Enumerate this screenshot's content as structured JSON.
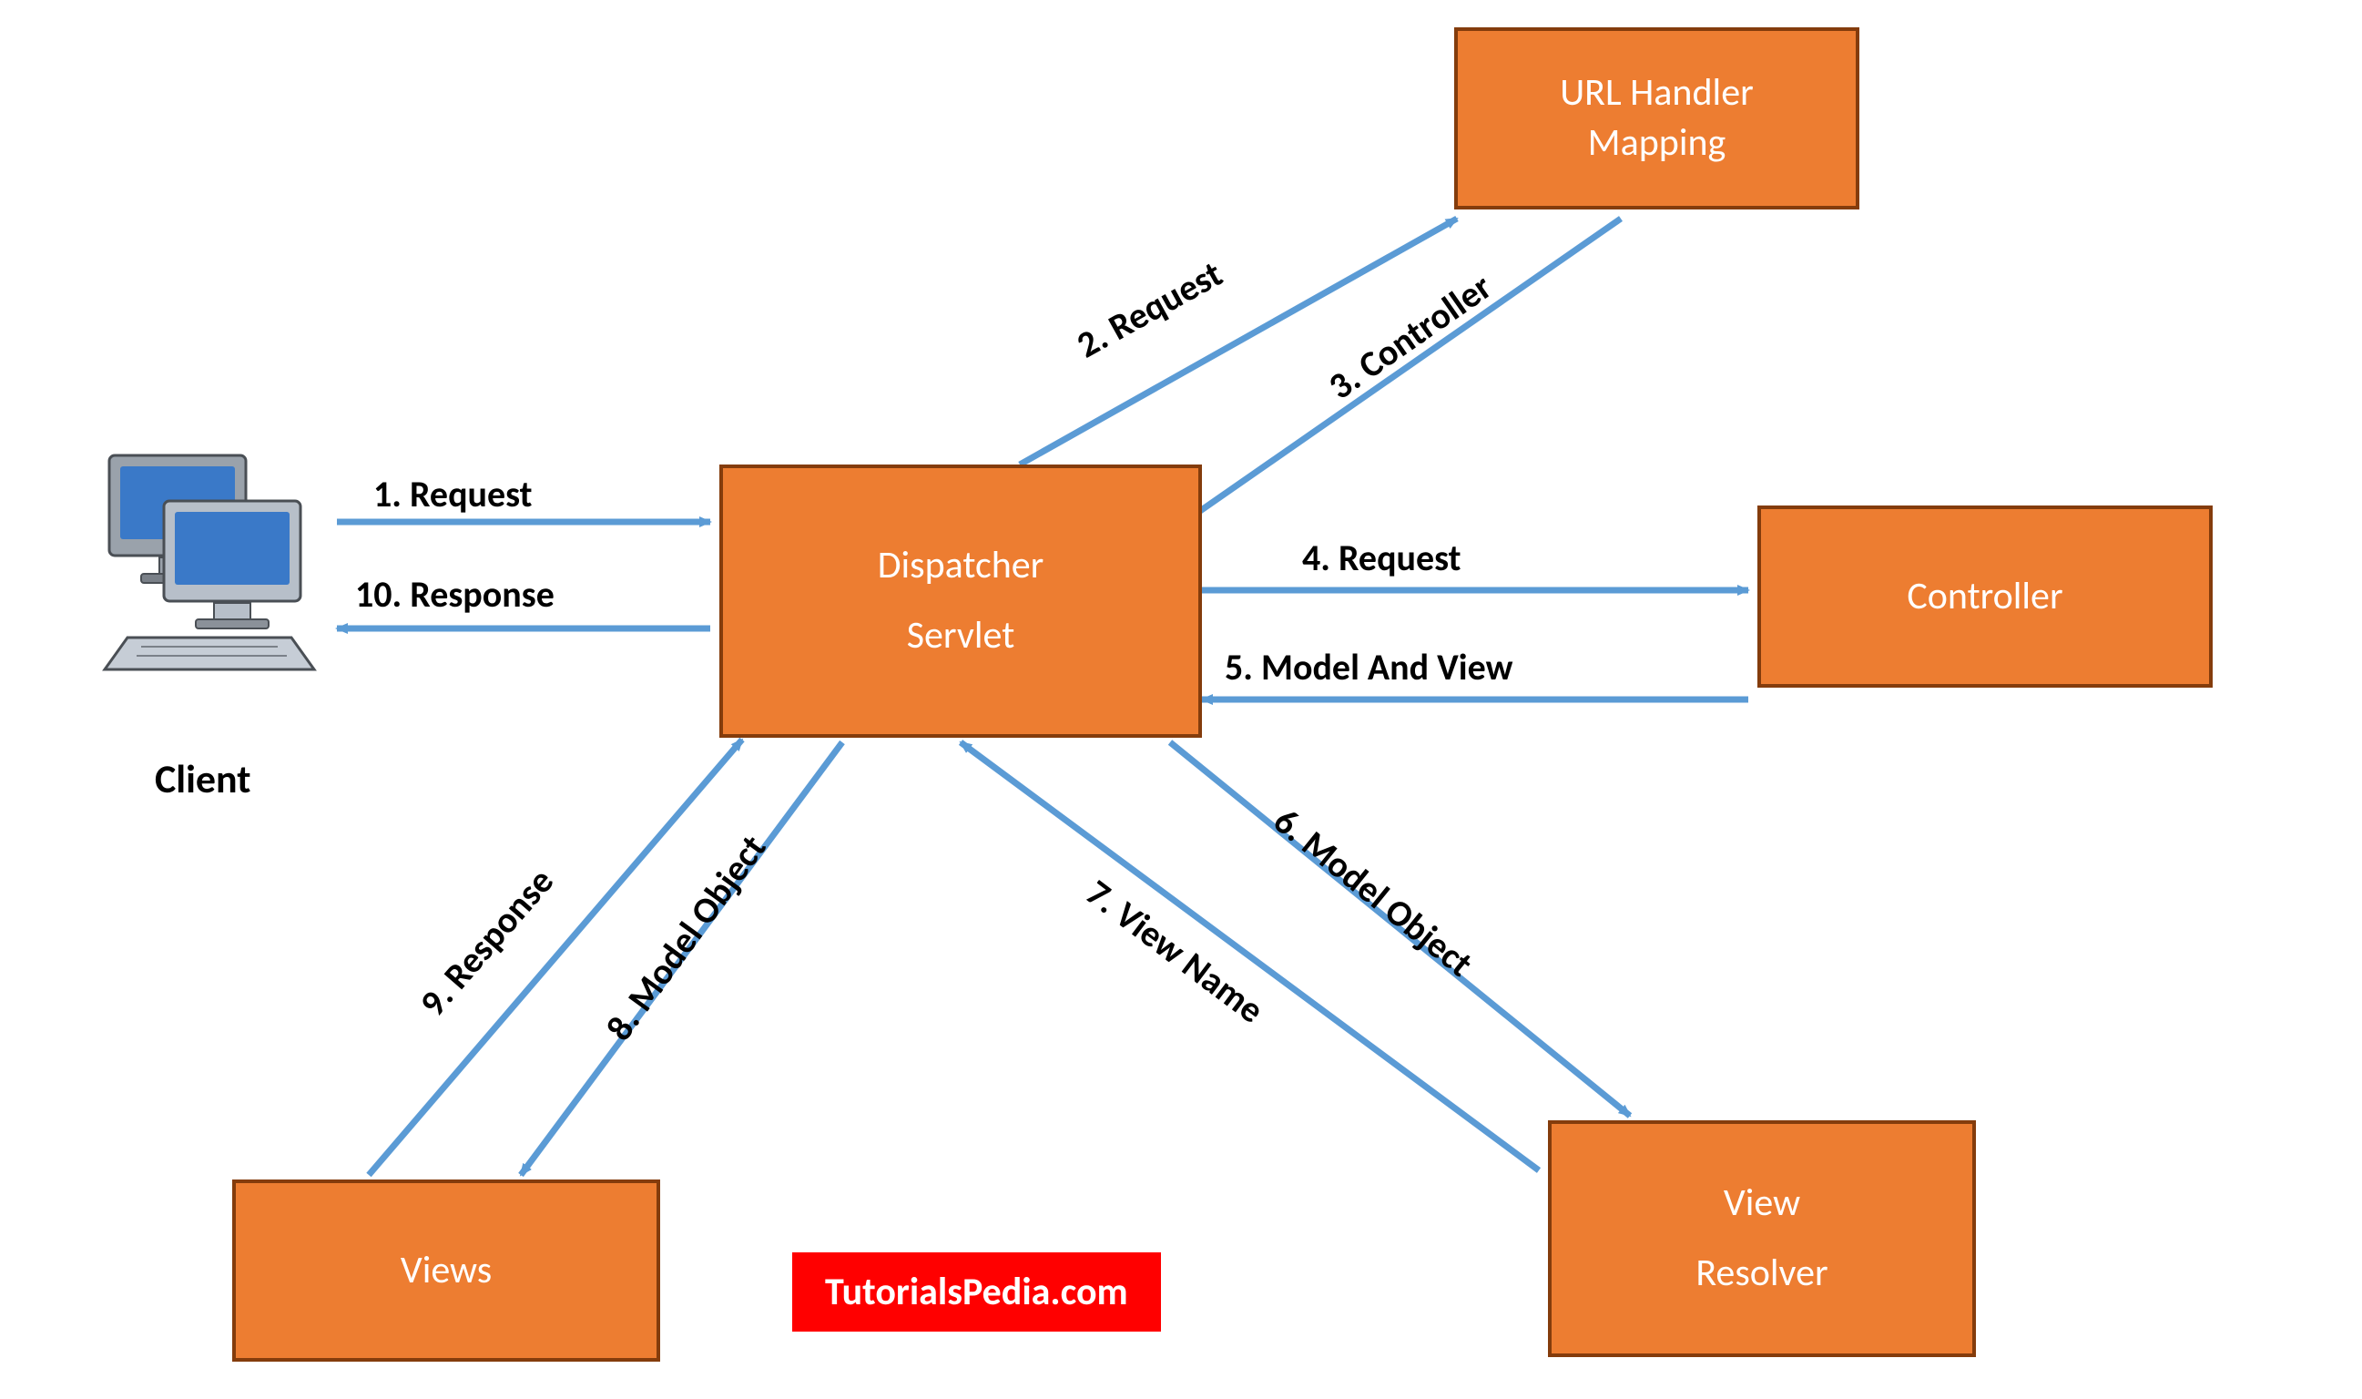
{
  "nodes": {
    "client": {
      "label": "Client"
    },
    "dispatcher": {
      "line1": "Dispatcher",
      "line2": "Servlet"
    },
    "urlhandler": {
      "line1": "URL Handler",
      "line2": "Mapping"
    },
    "controller": {
      "label": "Controller"
    },
    "viewresolver": {
      "line1": "View",
      "line2": "Resolver"
    },
    "views": {
      "label": "Views"
    }
  },
  "edges": {
    "e1": "1. Request",
    "e2": "2. Request",
    "e3": "3. Controller",
    "e4": "4. Request",
    "e5": "5. Model And View",
    "e6": "6. Model Object",
    "e7": "7. View Name",
    "e8": "8. Model Object",
    "e9": "9. Response",
    "e10": "10. Response"
  },
  "watermark": "TutorialsPedia.com",
  "colors": {
    "box_fill": "#ed7d31",
    "box_border": "#843c0c",
    "arrow": "#5b9bd5",
    "watermark_bg": "#ff0000"
  }
}
